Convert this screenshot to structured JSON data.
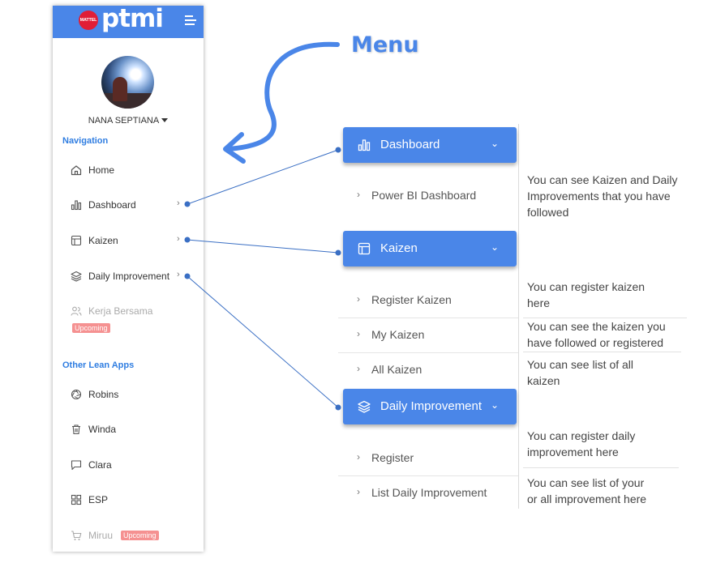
{
  "brand": {
    "badge": "MATTEL",
    "logo": "ptmi",
    "header_color": "#4a86e8"
  },
  "user": {
    "name": "NANA SEPTIANA"
  },
  "navigation": {
    "title": "Navigation",
    "items": [
      {
        "label": "Home",
        "icon": "home-icon"
      },
      {
        "label": "Dashboard",
        "icon": "bar-chart-icon"
      },
      {
        "label": "Kaizen",
        "icon": "layout-icon"
      },
      {
        "label": "Daily Improvement",
        "icon": "layers-icon"
      },
      {
        "label": "Kerja Bersama",
        "icon": "users-icon",
        "badge": "Upcoming"
      }
    ]
  },
  "other_apps": {
    "title": "Other Lean Apps",
    "items": [
      {
        "label": "Robins",
        "icon": "aperture-icon"
      },
      {
        "label": "Winda",
        "icon": "trash-icon"
      },
      {
        "label": "Clara",
        "icon": "message-icon"
      },
      {
        "label": "ESP",
        "icon": "grid-icon"
      },
      {
        "label": "Miruu",
        "icon": "cart-icon",
        "badge": "Upcoming"
      }
    ]
  },
  "annotation": {
    "menu_label": "Menu",
    "accent": "#4a86e8"
  },
  "panel": {
    "dashboard": {
      "label": "Dashboard",
      "sub": [
        "Power BI Dashboard"
      ]
    },
    "kaizen": {
      "label": "Kaizen",
      "sub": [
        "Register Kaizen",
        "My Kaizen",
        "All Kaizen"
      ]
    },
    "daily": {
      "label": "Daily Improvement",
      "sub": [
        "Register",
        "List Daily Improvement"
      ]
    }
  },
  "descriptions": {
    "dashboard": [
      "You can see Kaizen and Daily",
      "Improvements that you have",
      "followed"
    ],
    "register_kaizen": [
      "You can register kaizen",
      "here"
    ],
    "my_kaizen": [
      "You can see the kaizen you",
      "have followed or registered"
    ],
    "all_kaizen": [
      "You can see list of all",
      "kaizen"
    ],
    "register_daily": [
      "You can register daily",
      "improvement here"
    ],
    "list_daily": [
      "You can see list of your",
      "or all improvement here"
    ]
  }
}
